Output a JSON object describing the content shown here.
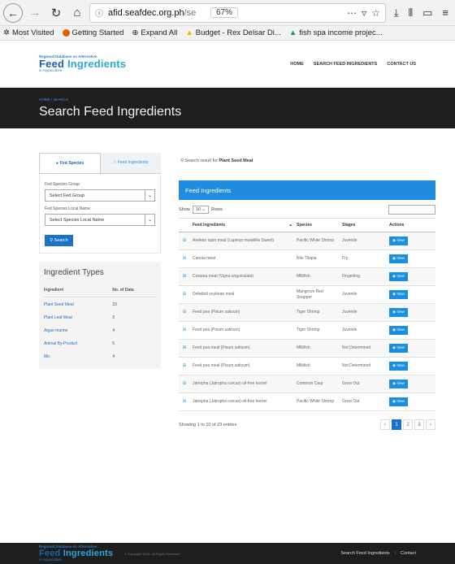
{
  "browser": {
    "url_domain": "afid.seafdec.org.ph",
    "url_rest": "/se",
    "zoom": "67%",
    "bookmarks": [
      "Most Visited",
      "Getting Started",
      "Expand All",
      "Budget - Rex Delsar Di...",
      "fish spa income projec..."
    ]
  },
  "header": {
    "logo_top": "Regional Database on Alternative",
    "logo_main_a": "Feed ",
    "logo_main_b": "Ingredients",
    "logo_bottom": "in Aquaculture",
    "nav": [
      "HOME",
      "SEARCH FEED INGREDIENTS",
      "CONTACT US"
    ]
  },
  "banner": {
    "crumb": "HOME / SEARCH",
    "title": "Search Feed Ingredients"
  },
  "sidebar": {
    "tabs": [
      "Fed Species",
      "Feed Ingredients"
    ],
    "group_label": "Fed Species Group",
    "group_select": "Select Fed Group",
    "local_label": "Fed Species Local Name",
    "local_select": "Select Species Local Name",
    "search_btn": "Search",
    "types_title": "Ingredient Types",
    "types_headers": [
      "Ingredient",
      "No. of Data"
    ],
    "types": [
      {
        "name": "Plant Seed Meal",
        "count": "23"
      },
      {
        "name": "Plant Leaf Meal",
        "count": "3"
      },
      {
        "name": "Algae marine",
        "count": "4"
      },
      {
        "name": "Animal By-Product",
        "count": "5"
      },
      {
        "name": "Mic",
        "count": "4"
      }
    ]
  },
  "main": {
    "search_prefix": "Search result for ",
    "search_term": "Plant Seed Meal",
    "panel_title": "Feed Ingredients",
    "show_label": "Show",
    "show_value": "10",
    "rows_label": "Rows",
    "headers": [
      "Feed Ingredients",
      "Species",
      "Stages",
      "Actions"
    ],
    "view_label": "View",
    "rows": [
      {
        "ingredient": "Andean lupin meal (Lupinus mutabilis Sweet)",
        "species": "Pacific White Shrimp",
        "stage": "Juvenile"
      },
      {
        "ingredient": "Canola meal",
        "species": "Nile Tilapia",
        "stage": "Fry"
      },
      {
        "ingredient": "Cowpea meal (Vigna unguiculata)",
        "species": "Milkfish",
        "stage": "Fingerling"
      },
      {
        "ingredient": "Defatted soybean meal",
        "species": "Mangrove Red Snapper",
        "stage": "Juvenile"
      },
      {
        "ingredient": "Feed pea (Pisum sativum)",
        "species": "Tiger Shrimp",
        "stage": "Juvenile"
      },
      {
        "ingredient": "Feed pea (Pisum sativum)",
        "species": "Tiger Shrimp",
        "stage": "Juvenile"
      },
      {
        "ingredient": "Feed pea meal (Pisum sativum)",
        "species": "Milkfish",
        "stage": "Not Determined"
      },
      {
        "ingredient": "Feed pea meal (Pisum sativum)",
        "species": "Milkfish",
        "stage": "Not Determined"
      },
      {
        "ingredient": "Jatropha (Jatropha curcas) oil-free kernel",
        "species": "Common Carp",
        "stage": "Grow Out"
      },
      {
        "ingredient": "Jatropha (Jatropha curcas) oil-free kernel",
        "species": "Pacific White Shrimp",
        "stage": "Grow Out"
      }
    ],
    "showing": "Showing 1 to 10 of 23 entries",
    "pages": [
      "‹",
      "1",
      "2",
      "3",
      "›"
    ]
  },
  "footer": {
    "copyright": "© Copyright 2018. All Rights Reserved.",
    "links": [
      "Search Feed Ingredients",
      "Contact"
    ]
  }
}
